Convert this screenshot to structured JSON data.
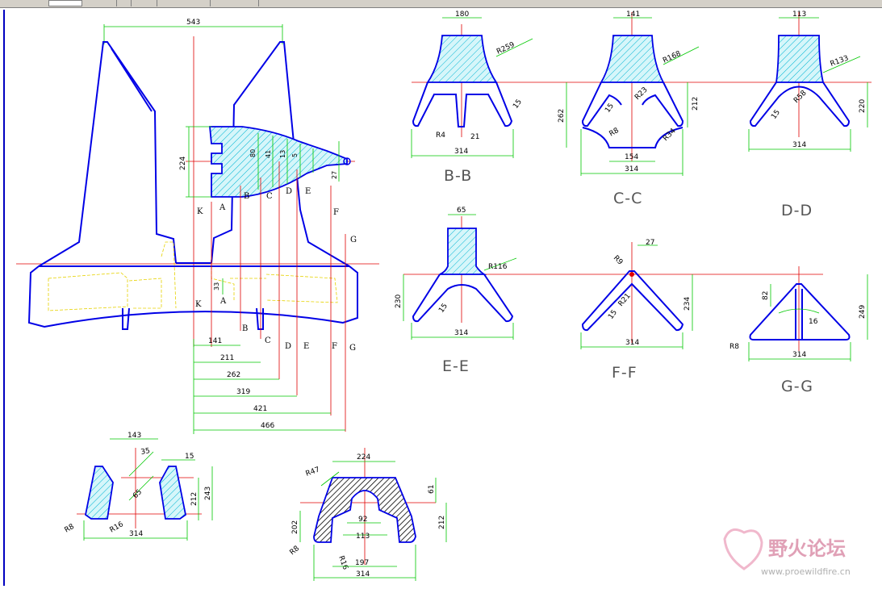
{
  "sections": {
    "bb": "B-B",
    "cc": "C-C",
    "dd": "D-D",
    "ee": "E-E",
    "ff": "F-F",
    "gg": "G-G"
  },
  "main": {
    "top_width": "543",
    "height": "224",
    "dims_horiz": [
      "141",
      "211",
      "262",
      "319",
      "421",
      "466"
    ],
    "small": [
      "80",
      "41",
      "13",
      "5",
      "27",
      "33"
    ],
    "labels": [
      "A",
      "B",
      "C",
      "D",
      "E",
      "F",
      "G",
      "K"
    ]
  },
  "bb": {
    "top": "180",
    "r": "R259",
    "t": "15",
    "r4": "R4",
    "w21": "21",
    "w": "314"
  },
  "cc": {
    "top": "141",
    "r": "R168",
    "t": "15",
    "h": "262",
    "h2": "212",
    "r8": "R8",
    "r34": "R34",
    "r23": "R23",
    "bot": "154",
    "w": "314"
  },
  "dd": {
    "top": "113",
    "r": "R133",
    "h": "220",
    "r58": "R58",
    "t": "15",
    "w": "314"
  },
  "ee": {
    "top": "65",
    "r": "R116",
    "h": "230",
    "t": "15",
    "w": "314"
  },
  "ff": {
    "top": "27",
    "r9": "R9",
    "h": "234",
    "r21": "R21",
    "t": "15",
    "w": "314"
  },
  "gg": {
    "h1": "82",
    "h": "249",
    "t": "16",
    "r8": "R8",
    "w": "314"
  },
  "kk": {
    "top": "143",
    "a": "35",
    "t": "15",
    "h1": "243",
    "h2": "212",
    "b": "65",
    "r8": "R8",
    "r16": "R16",
    "w": "314"
  },
  "bot2": {
    "top": "224",
    "r47": "R47",
    "h61": "61",
    "h212": "212",
    "h202": "202",
    "w92": "92",
    "w113": "113",
    "r8": "R8",
    "r16": "R16",
    "w197": "197",
    "w": "314"
  },
  "watermark": {
    "cn": "野火论坛",
    "url": "www.proewildfire.cn"
  }
}
